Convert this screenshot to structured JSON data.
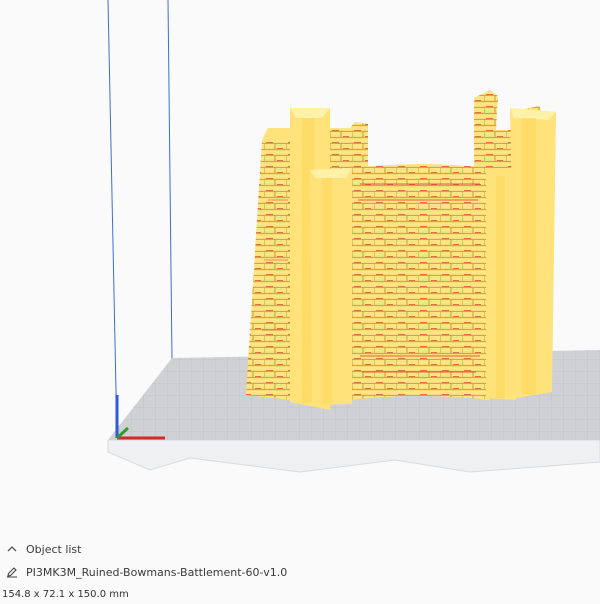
{
  "panel": {
    "object_list_label": "Object list",
    "filename": "PI3MK3M_Ruined-Bowmans-Battlement-60-v1.0",
    "dimensions": "154.8 x 72.1 x 150.0 mm"
  },
  "icons": {
    "object_list_toggle": "chevron-up-icon",
    "edit_name": "pencil-icon"
  },
  "viewport": {
    "model_name": "ruined-battlement",
    "colors": {
      "background": "#fafafa",
      "build_plate": "#cfd1d4",
      "grid_lines": "#b9bcc0",
      "model_fill": "#ffe27a",
      "model_shade": "#e9c24a",
      "overhang": "#d8322a",
      "axis_x": "#d62828",
      "axis_y": "#2d9c2d",
      "axis_z": "#2e5bd6",
      "volume_line": "#3b6fd6"
    }
  }
}
